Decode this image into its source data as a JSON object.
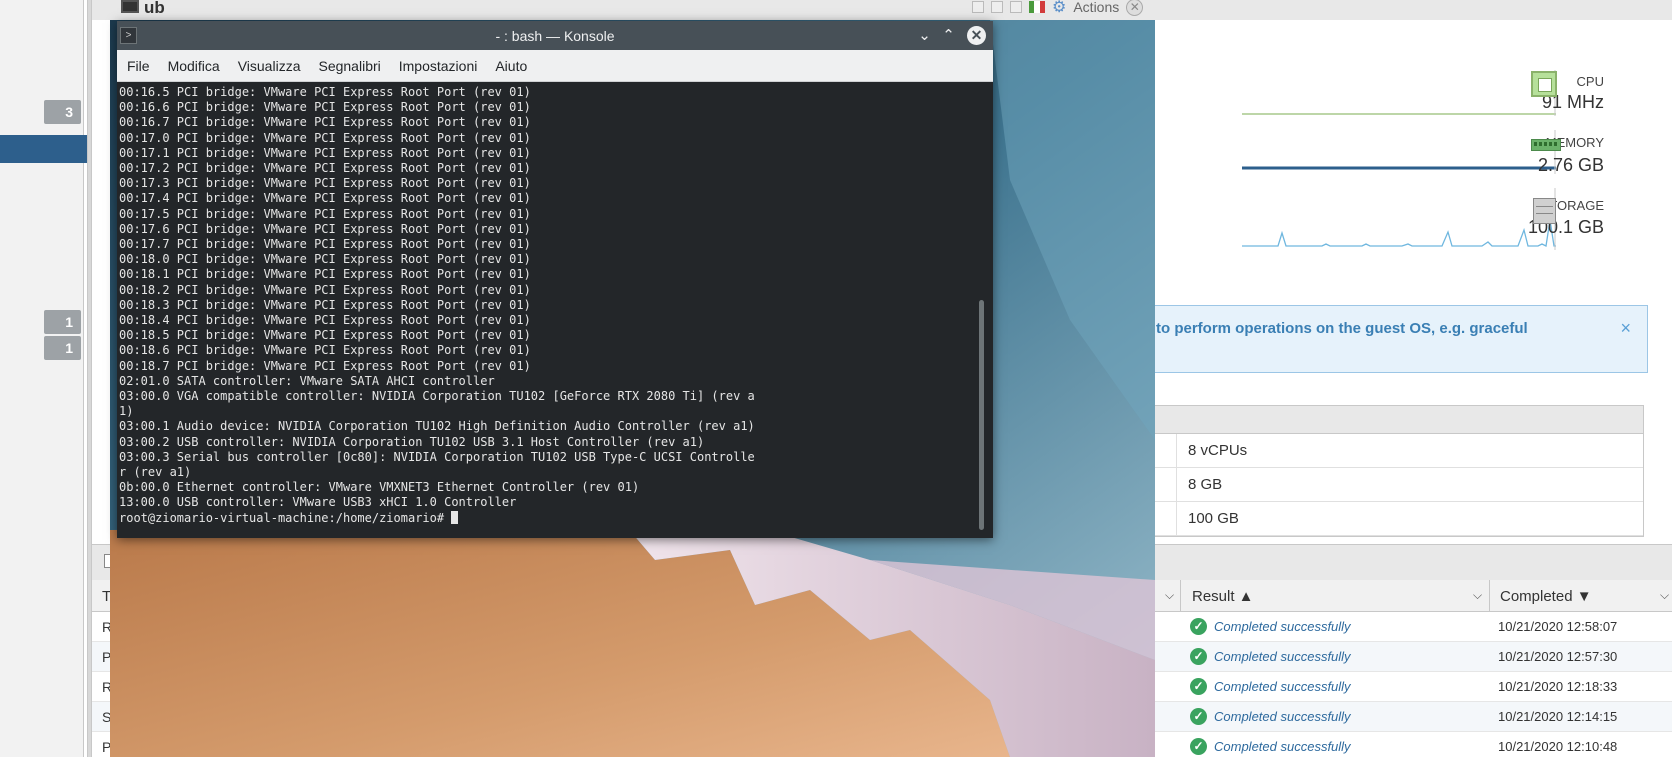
{
  "sidebar": {
    "badges": [
      "3",
      "1",
      "1"
    ]
  },
  "vm": {
    "title": "ub",
    "actions_label": "Actions"
  },
  "resources": {
    "cpu": {
      "label": "CPU",
      "value": "91 MHz"
    },
    "memory": {
      "label": "MEMORY",
      "value": "2.76 GB"
    },
    "storage": {
      "label": "STORAGE",
      "value": "100.1 GB"
    }
  },
  "notice": {
    "text": "to perform operations on the guest OS, e.g. graceful",
    "close": "×"
  },
  "specs": {
    "rows": [
      "8 vCPUs",
      "8 GB",
      "100 GB"
    ]
  },
  "tasks": {
    "columns": {
      "task": "Ta",
      "result": "Result ▲",
      "completed": "Completed ▼"
    },
    "rows": [
      {
        "name": "Re",
        "result": "Completed successfully",
        "completed": "10/21/2020 12:58:07"
      },
      {
        "name": "Po",
        "result": "Completed successfully",
        "completed": "10/21/2020 12:57:30"
      },
      {
        "name": "Re",
        "result": "Completed successfully",
        "completed": "10/21/2020 12:18:33"
      },
      {
        "name": "Sh",
        "result": "Completed successfully",
        "completed": "10/21/2020 12:14:15"
      },
      {
        "name": "Po",
        "result": "Completed successfully",
        "completed": "10/21/2020 12:10:48"
      }
    ]
  },
  "konsole": {
    "title": "- : bash — Konsole",
    "menu": [
      "File",
      "Modifica",
      "Visualizza",
      "Segnalibri",
      "Impostazioni",
      "Aiuto"
    ],
    "lines": [
      "00:16.5 PCI bridge: VMware PCI Express Root Port (rev 01)",
      "00:16.6 PCI bridge: VMware PCI Express Root Port (rev 01)",
      "00:16.7 PCI bridge: VMware PCI Express Root Port (rev 01)",
      "00:17.0 PCI bridge: VMware PCI Express Root Port (rev 01)",
      "00:17.1 PCI bridge: VMware PCI Express Root Port (rev 01)",
      "00:17.2 PCI bridge: VMware PCI Express Root Port (rev 01)",
      "00:17.3 PCI bridge: VMware PCI Express Root Port (rev 01)",
      "00:17.4 PCI bridge: VMware PCI Express Root Port (rev 01)",
      "00:17.5 PCI bridge: VMware PCI Express Root Port (rev 01)",
      "00:17.6 PCI bridge: VMware PCI Express Root Port (rev 01)",
      "00:17.7 PCI bridge: VMware PCI Express Root Port (rev 01)",
      "00:18.0 PCI bridge: VMware PCI Express Root Port (rev 01)",
      "00:18.1 PCI bridge: VMware PCI Express Root Port (rev 01)",
      "00:18.2 PCI bridge: VMware PCI Express Root Port (rev 01)",
      "00:18.3 PCI bridge: VMware PCI Express Root Port (rev 01)",
      "00:18.4 PCI bridge: VMware PCI Express Root Port (rev 01)",
      "00:18.5 PCI bridge: VMware PCI Express Root Port (rev 01)",
      "00:18.6 PCI bridge: VMware PCI Express Root Port (rev 01)",
      "00:18.7 PCI bridge: VMware PCI Express Root Port (rev 01)",
      "02:01.0 SATA controller: VMware SATA AHCI controller",
      "03:00.0 VGA compatible controller: NVIDIA Corporation TU102 [GeForce RTX 2080 Ti] (rev a",
      "1)",
      "03:00.1 Audio device: NVIDIA Corporation TU102 High Definition Audio Controller (rev a1)",
      "03:00.2 USB controller: NVIDIA Corporation TU102 USB 3.1 Host Controller (rev a1)",
      "03:00.3 Serial bus controller [0c80]: NVIDIA Corporation TU102 USB Type-C UCSI Controlle",
      "r (rev a1)",
      "0b:00.0 Ethernet controller: VMware VMXNET3 Ethernet Controller (rev 01)",
      "13:00.0 USB controller: VMware USB3 xHCI 1.0 Controller"
    ],
    "prompt": "root@ziomario-virtual-machine:/home/ziomario# "
  },
  "colors": {
    "sidebar_selected": "#2d5f8c",
    "success": "#3aa35f",
    "link": "#2e6a9e",
    "konsole_bg": "#232629",
    "konsole_titlebar": "#475057"
  }
}
